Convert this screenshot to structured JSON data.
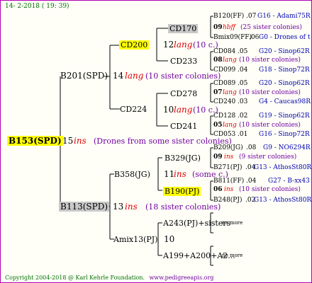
{
  "header": {
    "date_time": "14- 2-2018 ( 19: 39)"
  },
  "root": {
    "id": "B153(SPD)",
    "num": "15",
    "ins": "ins",
    "note": "(Drones from some sister colonies)"
  },
  "gen1": [
    {
      "id": "B201(SPD)",
      "num": "14",
      "lang": "lang",
      "note": "(10 sister colonies)"
    },
    {
      "id": "B113(SPD)",
      "num": "13",
      "ins": "ins",
      "note": "(18 sister colonies)"
    }
  ],
  "gen2": [
    {
      "id": "CD200",
      "num": "12",
      "lang": "lang",
      "note": "(10 c.)"
    },
    {
      "id": "CD224",
      "num": "10",
      "lang": "lang",
      "note": "(10 c.)"
    },
    {
      "id": "B358(JG)",
      "num": "11",
      "ins": "ins",
      "note": "(some c.)"
    },
    {
      "id": "Amix13(PJ)",
      "num": "10"
    }
  ],
  "gen3": [
    {
      "id": "CD170",
      "num": "09",
      "tag": "hbff",
      "note": "(25 sister colonies)"
    },
    {
      "id": "CD233",
      "num": "08",
      "tag": "lang",
      "note": "(10 sister colonies)"
    },
    {
      "id": "CD278",
      "num": "07",
      "tag": "lang",
      "note": "(10 sister colonies)"
    },
    {
      "id": "CD241",
      "num": "05",
      "tag": "lang",
      "note": "(10 sister colonies)"
    },
    {
      "id": "B329(JG)",
      "num": "09",
      "tag": "ins",
      "note": "(9 sister colonies)"
    },
    {
      "id": "B190(PJ)",
      "num": "06",
      "tag": "ins",
      "note": "(10 sister colonies)"
    },
    {
      "id": "A243(PJ)+sisters",
      "more": "no more"
    },
    {
      "id": "A199+A200+A2...",
      "more": "no more"
    }
  ],
  "gen4": [
    {
      "id": "B120(FF)",
      "num": ".07",
      "origin": "G16 - Adami75R"
    },
    {
      "id": "Bmix09(FF)",
      "num": ".06",
      "origin": "G0 - Drones of t"
    },
    {
      "id": "CD084",
      "num": ".05",
      "origin": "G20 - Sinop62R"
    },
    {
      "id": "CD099",
      "num": ".04",
      "origin": "G18 - Sinop72R"
    },
    {
      "id": "CD089",
      "num": ".05",
      "origin": "G20 - Sinop62R"
    },
    {
      "id": "CD240",
      "num": ".03",
      "origin": "G4 - Caucas98R"
    },
    {
      "id": "CD128",
      "num": ".02",
      "origin": "G19 - Sinop62R"
    },
    {
      "id": "CD053",
      "num": ".01",
      "origin": "G16 - Sinop72R"
    },
    {
      "id": "B209(JG)",
      "num": ".08",
      "origin": "G9 - NO6294R"
    },
    {
      "id": "B271(PJ)",
      "num": ".04",
      "origin": "G13 - AthosSt80R"
    },
    {
      "id": "B811(FF)",
      "num": ".04",
      "origin": "G27 - B-xx43"
    },
    {
      "id": "B248(PJ)",
      "num": ".02",
      "origin": "G13 - AthosSt80R"
    }
  ],
  "footer": {
    "copyright": "Copyright 2004-2018 @ Karl Kehrle Foundation.",
    "site": "www.pedigreeapis.org"
  }
}
